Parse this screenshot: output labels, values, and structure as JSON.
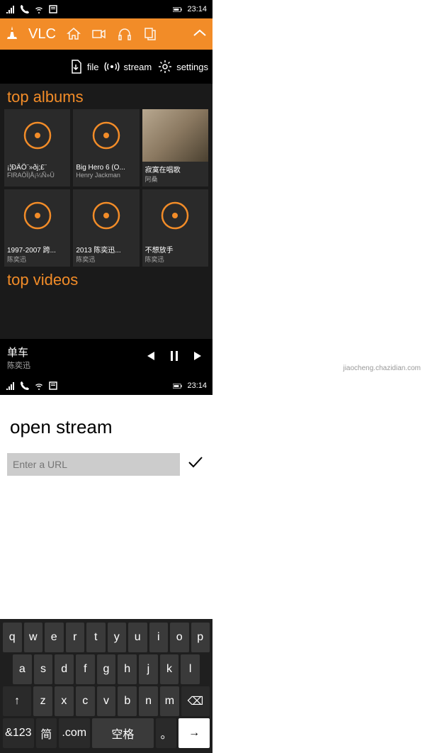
{
  "status": {
    "time": "23:14"
  },
  "vlc": {
    "title": "VLC",
    "actions": {
      "file": "file",
      "stream": "stream",
      "settings": "settings"
    },
    "top_albums_label": "top albums",
    "albums": [
      {
        "title": "¡¦ÐÄÖ¨»ðj;£¨",
        "artist": "FIRAÖÏ|Å¡¼Ñ»Û"
      },
      {
        "title": "Big Hero 6 (O...",
        "artist": "Henry Jackman"
      },
      {
        "title": "寂寞在唱歌",
        "artist": "阿桑",
        "photo": true
      },
      {
        "title": "1997-2007 跨...",
        "artist": "陈奕迅"
      },
      {
        "title": "2013 陈奕迅...",
        "artist": "陈奕迅"
      },
      {
        "title": "不想放手",
        "artist": "陈奕迅"
      }
    ],
    "top_videos_label": "top videos",
    "now_playing": {
      "title": "单车",
      "artist": "陈奕迅"
    }
  },
  "stream": {
    "title": "open stream",
    "placeholder": "Enter a URL"
  },
  "keyboard": {
    "row1": [
      "q",
      "w",
      "e",
      "r",
      "t",
      "y",
      "u",
      "i",
      "o",
      "p"
    ],
    "row2": [
      "a",
      "s",
      "d",
      "f",
      "g",
      "h",
      "j",
      "k",
      "l"
    ],
    "row3_shift": "↑",
    "row3": [
      "z",
      "x",
      "c",
      "v",
      "b",
      "n",
      "m"
    ],
    "row3_back": "⌫",
    "row4": {
      "numbers": "&123",
      "lang": "简",
      "com": ".com",
      "space": "空格",
      "period": "。",
      "enter": "→"
    }
  },
  "watermark": "jiaocheng.chazidian.com"
}
